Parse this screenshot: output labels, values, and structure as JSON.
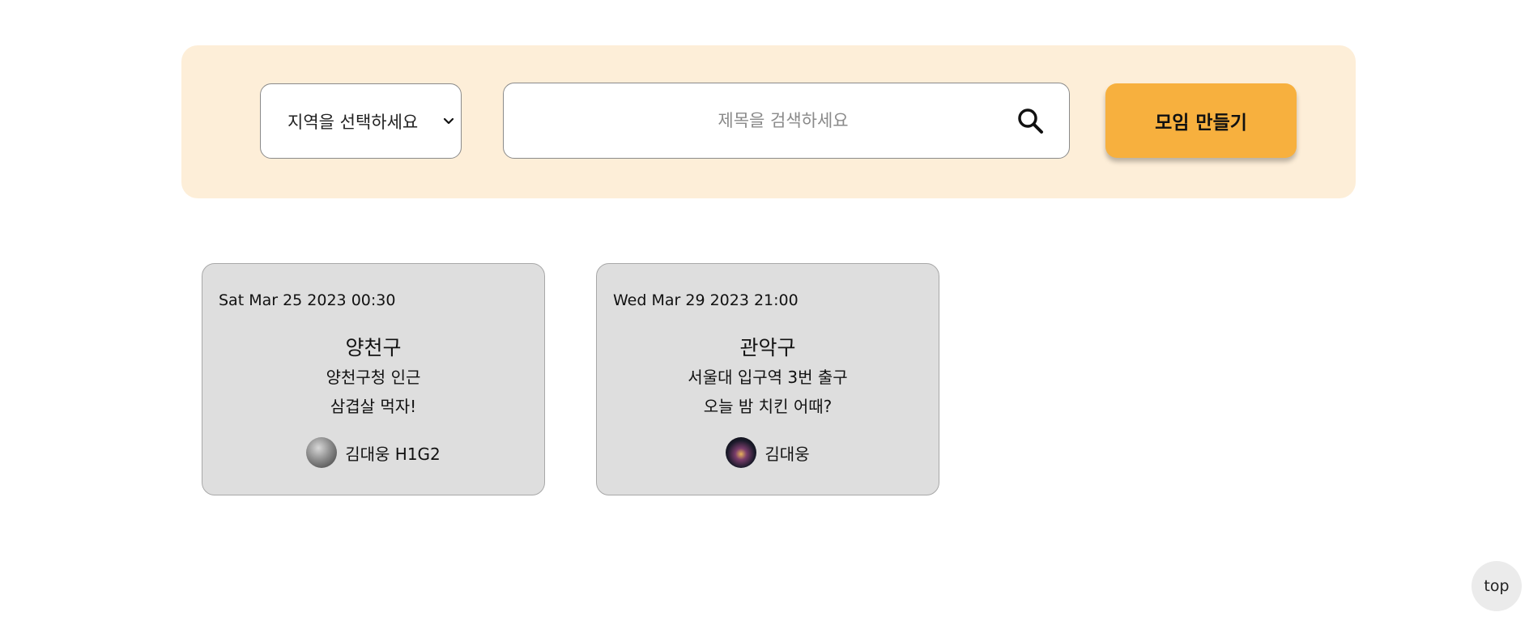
{
  "search_panel": {
    "region_select": {
      "selected": "지역을 선택하세요"
    },
    "search": {
      "placeholder": "제목을 검색하세요",
      "value": ""
    },
    "create_button_label": "모임 만들기"
  },
  "cards": [
    {
      "date": "Sat Mar 25 2023 00:30",
      "region": "양천구",
      "place": "양천구청 인근",
      "title": "삼겹살 먹자!",
      "author": "김대웅 H1G2"
    },
    {
      "date": "Wed Mar 29 2023 21:00",
      "region": "관악구",
      "place": "서울대 입구역 3번 출구",
      "title": "오늘 밤 치킨 어때?",
      "author": "김대웅"
    }
  ],
  "top_button_label": "top",
  "colors": {
    "panel_bg": "#fdeed8",
    "accent": "#f7b03e",
    "card_bg": "#dedede"
  }
}
